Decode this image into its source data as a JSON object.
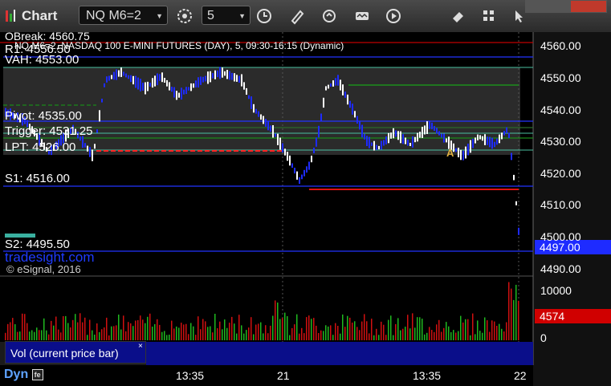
{
  "app": {
    "title": "Chart"
  },
  "toolbar": {
    "symbol": "NQ M6=2",
    "interval": "5",
    "icons": [
      "gear-icon",
      "clock-icon",
      "pencil-icon",
      "link-icon",
      "wave-icon",
      "play-icon",
      "eraser-icon",
      "grid-icon",
      "cursor-icon"
    ]
  },
  "chart": {
    "header": "NQ M6=2, NASDAQ 100 E-MINI FUTURES (DAY), 5, 09:30-16:15 (Dynamic)",
    "header_top_left": "OBreak: 4560.75",
    "levels": [
      {
        "label": "R1: 4556.50"
      },
      {
        "label": "VAH: 4553.00"
      },
      {
        "label": "Pivot: 4535.00"
      },
      {
        "label": "Trigger: 4531.25"
      },
      {
        "label": "LPT: 4526.00"
      },
      {
        "label": "S1: 4516.00"
      },
      {
        "label": "S2: 4495.50"
      }
    ],
    "y_axis": [
      "4560.00",
      "4550.00",
      "4540.00",
      "4530.00",
      "4520.00",
      "4510.00",
      "4500.00",
      "4490.00"
    ],
    "current_price": "4497.00",
    "watermark": "tradesight.com",
    "copyright": "© eSignal, 2016",
    "marker_a": "A"
  },
  "volume": {
    "label": "Vol (current price bar)",
    "close": "×",
    "axis": [
      "10000",
      "0"
    ],
    "current_value": "4574"
  },
  "footer": {
    "mode": "Dyn",
    "time_labels": [
      "13:35",
      "21",
      "13:35",
      "22"
    ]
  },
  "colors": {
    "up_bar": "#ffffff",
    "down_bar": "#1e2bff",
    "price_badge": "#1e2bff",
    "volume_badge": "#d00000",
    "pivot_line": "#2a6a2a"
  }
}
